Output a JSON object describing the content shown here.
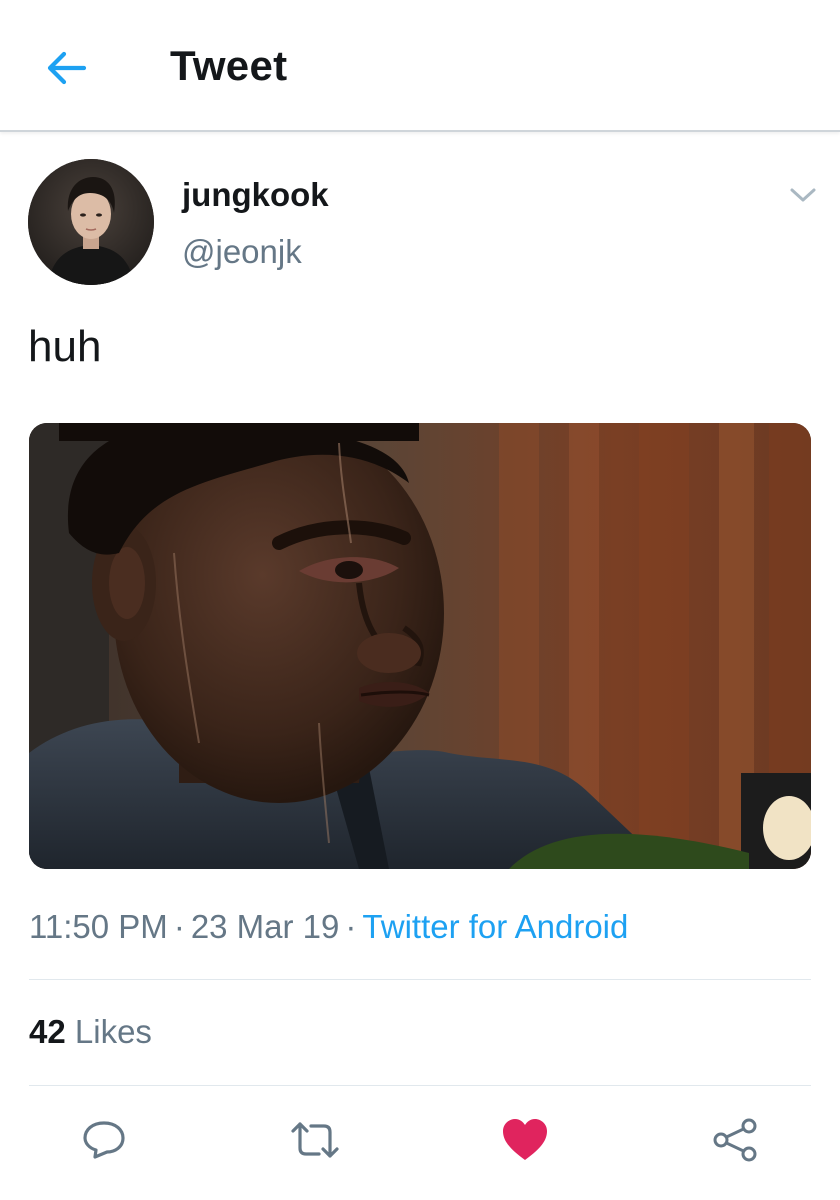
{
  "header": {
    "title": "Tweet",
    "back_icon": "arrow-left-icon"
  },
  "colors": {
    "accent": "#1da1f2",
    "like": "#e0245e",
    "secondary_text": "#657786",
    "primary_text": "#14171a"
  },
  "tweet": {
    "author": {
      "display_name": "jungkook",
      "handle": "@jeonjk"
    },
    "text": "huh",
    "meta": {
      "time": "11:50 PM",
      "date": "23 Mar 19",
      "separator": "·",
      "source": "Twitter for Android"
    },
    "likes": {
      "count": "42",
      "label": "Likes"
    },
    "liked": true
  },
  "actions": [
    {
      "icon": "reply-icon"
    },
    {
      "icon": "retweet-icon"
    },
    {
      "icon": "heart-icon"
    },
    {
      "icon": "share-icon"
    }
  ]
}
